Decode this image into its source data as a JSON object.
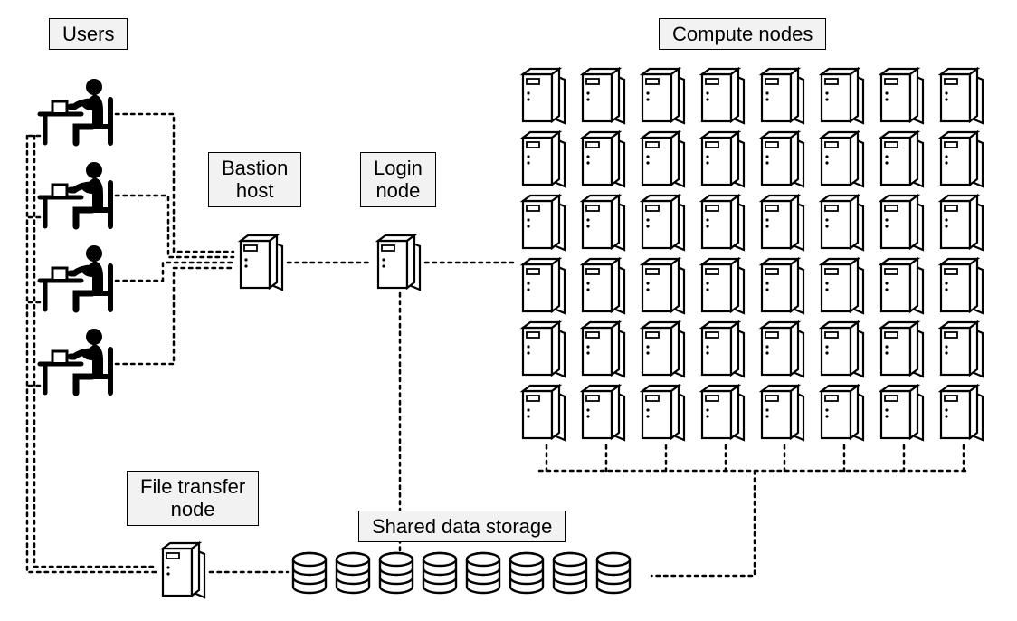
{
  "labels": {
    "users": "Users",
    "bastion": "Bastion\nhost",
    "login": "Login\nnode",
    "compute": "Compute nodes",
    "file_transfer": "File transfer\nnode",
    "storage": "Shared data storage"
  },
  "diagram": {
    "nodes": {
      "users": {
        "count": 4,
        "type": "workstation-user"
      },
      "bastion_host": {
        "count": 1,
        "type": "server"
      },
      "login_node": {
        "count": 1,
        "type": "server"
      },
      "file_transfer_node": {
        "count": 1,
        "type": "server"
      },
      "compute_nodes": {
        "rows": 6,
        "cols": 8,
        "type": "server"
      },
      "shared_storage": {
        "disks": 8,
        "type": "disk-stack"
      }
    },
    "edges": [
      {
        "from": "users",
        "to": "bastion_host",
        "style": "dotted"
      },
      {
        "from": "bastion_host",
        "to": "login_node",
        "style": "dotted"
      },
      {
        "from": "login_node",
        "to": "compute_nodes",
        "style": "dotted"
      },
      {
        "from": "login_node",
        "to": "shared_storage",
        "style": "dotted"
      },
      {
        "from": "compute_nodes",
        "to": "shared_storage",
        "style": "dotted"
      },
      {
        "from": "users",
        "to": "file_transfer_node",
        "style": "dotted"
      },
      {
        "from": "file_transfer_node",
        "to": "shared_storage",
        "style": "dotted"
      }
    ]
  }
}
